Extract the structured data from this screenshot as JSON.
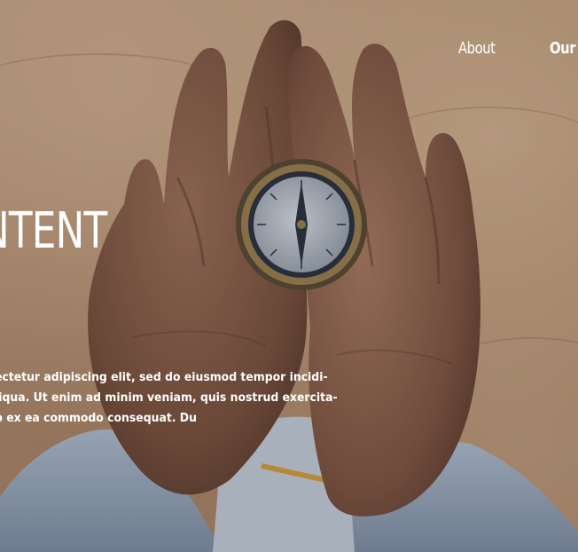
{
  "nav": {
    "items": [
      {
        "label": "About"
      },
      {
        "label": "Our Pr"
      }
    ]
  },
  "hero": {
    "headline": "NTENT",
    "body_lines": [
      "ectetur adipiscing elit, sed do eiusmod tempor incidi-",
      "liqua. Ut enim ad minim veniam, quis nostrud exercita-",
      "p ex ea commodo consequat. Du"
    ],
    "image_subject": "hands-holding-compass"
  },
  "colors": {
    "text": "#ffffff",
    "sand": "#b89474",
    "skin": "#8a5d45",
    "sleeve": "#a9b7c8"
  }
}
